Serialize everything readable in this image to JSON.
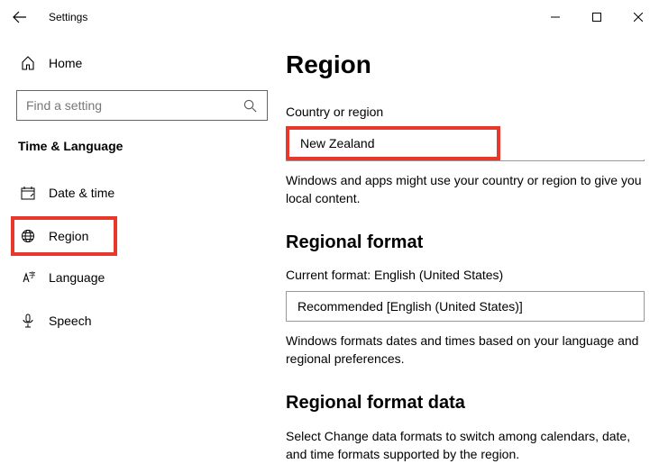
{
  "titlebar": {
    "title": "Settings"
  },
  "sidebar": {
    "home_label": "Home",
    "search_placeholder": "Find a setting",
    "category_header": "Time & Language",
    "items": [
      {
        "label": "Date & time"
      },
      {
        "label": "Region"
      },
      {
        "label": "Language"
      },
      {
        "label": "Speech"
      }
    ]
  },
  "main": {
    "heading": "Region",
    "country_label": "Country or region",
    "country_value": "New Zealand",
    "country_helper": "Windows and apps might use your country or region to give you local content.",
    "regional_format_heading": "Regional format",
    "current_format_label": "Current format: English (United States)",
    "format_dropdown_value": "Recommended [English (United States)]",
    "format_helper": "Windows formats dates and times based on your language and regional preferences.",
    "regional_format_data_heading": "Regional format data",
    "regional_format_data_helper": "Select Change data formats to switch among calendars, date, and time formats supported by the region."
  }
}
